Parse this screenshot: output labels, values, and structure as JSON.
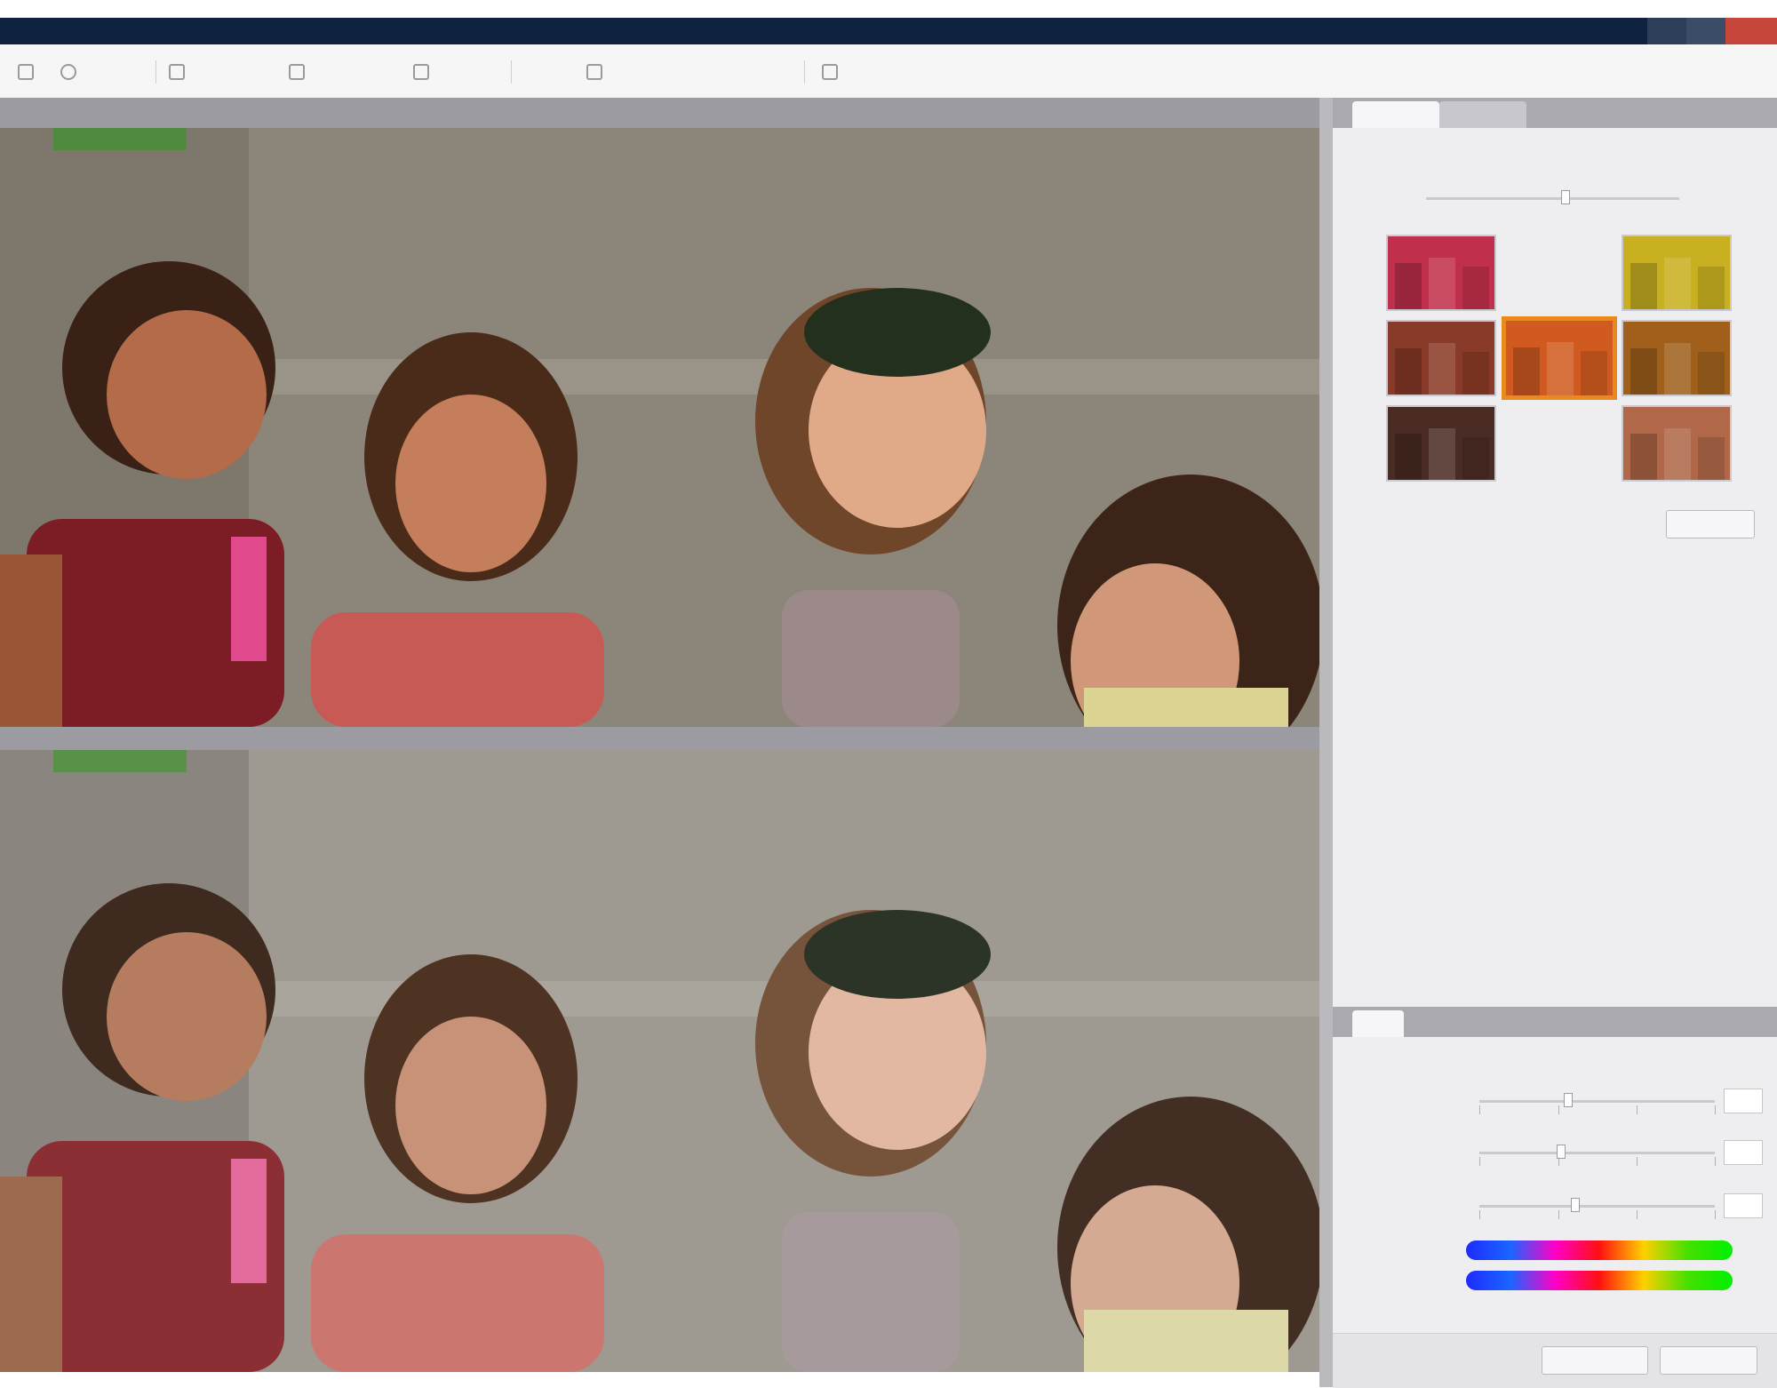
{
  "window": {
    "title": ""
  },
  "toolbar": {
    "items": [
      {
        "label": "",
        "icon": "view-icon"
      },
      {
        "label": "",
        "icon": "zoom-icon"
      },
      {
        "label": "",
        "icon": "zoom-level-icon"
      },
      {
        "label": "",
        "icon": "sample-size-icon"
      },
      {
        "label": "",
        "icon": "crop-icon"
      },
      {
        "label": "",
        "icon": "compare-icon"
      },
      {
        "label": "",
        "icon": "menu-icon"
      },
      {
        "label": "",
        "icon": "presets-icon"
      },
      {
        "label": "",
        "icon": "preview-icon"
      }
    ]
  },
  "panels": {
    "original_label": "",
    "preview_label": ""
  },
  "variations": {
    "tab_active": "",
    "tab_inactive": "",
    "instructions": "",
    "less_label": "",
    "more_label": "",
    "amount": 0.55,
    "reset_label": "",
    "selected_tint": "#e88a1d",
    "tints": [
      "#c0304c",
      "#c8b020",
      "#8a3a28",
      "#d05a20",
      "#a0601c",
      "#4a2c24",
      "#b06848"
    ]
  },
  "settings": {
    "tab_label": "",
    "sliders": [
      {
        "label": "",
        "value": ""
      },
      {
        "label": "",
        "value": ""
      },
      {
        "label": "",
        "value": ""
      }
    ],
    "spectrum_rows": [
      {
        "label": ""
      },
      {
        "label": ""
      }
    ],
    "apply_label": "",
    "close_label": ""
  }
}
